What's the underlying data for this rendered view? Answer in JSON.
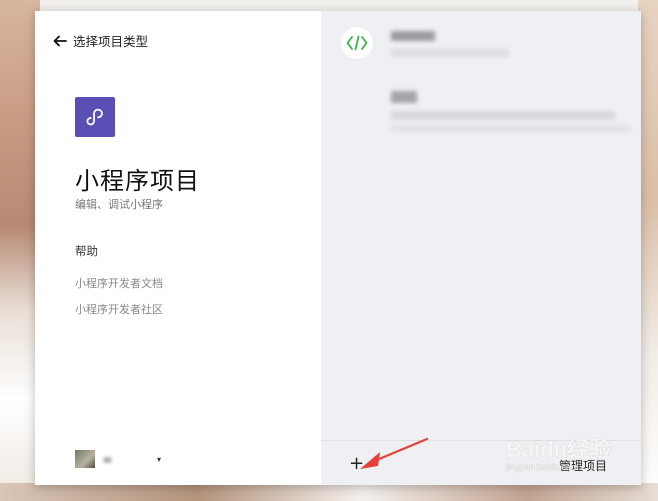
{
  "back": {
    "label": "选择项目类型",
    "icon": "arrow-left-icon"
  },
  "project": {
    "logo_icon": "mini-program-logo-icon",
    "title": "小程序项目",
    "subtitle": "编辑、调试小程序"
  },
  "help": {
    "heading": "帮助",
    "links": [
      "小程序开发者文档",
      "小程序开发者社区"
    ]
  },
  "user": {
    "name": "w",
    "caret": "▾"
  },
  "right_panel": {
    "code_icon": "code-brackets-icon",
    "footer": {
      "add_label": "+",
      "manage_label": "管理项目"
    }
  },
  "watermark": {
    "main": "Baidu经验",
    "sub": "jingyan.baidu.com"
  },
  "colors": {
    "accent": "#5a4fb4",
    "code_green": "#3cb54a",
    "arrow_red": "#e8403a"
  }
}
